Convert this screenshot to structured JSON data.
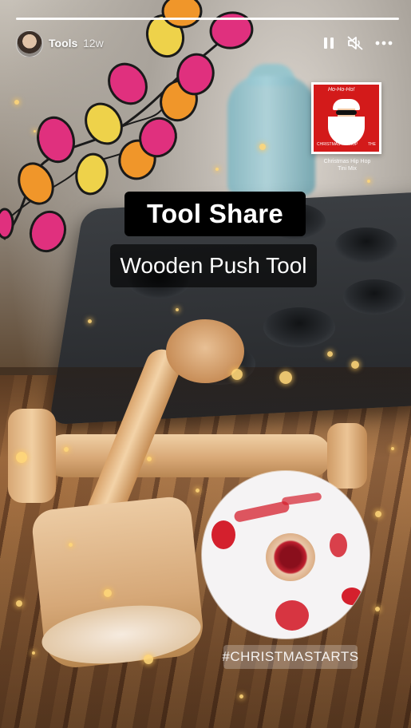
{
  "header": {
    "username": "Tools",
    "time_ago": "12w",
    "progress_fraction": 1.0
  },
  "controls": {
    "pause_icon": "pause-icon",
    "mute_icon": "speaker-muted-icon",
    "more_icon": "more-horizontal-icon"
  },
  "stickers": {
    "title": "Tool Share",
    "subtitle": "Wooden Push Tool",
    "hashtag": "#CHRISTMASTARTS"
  },
  "music": {
    "art_text": "Ho-Ho-Ho!",
    "art_brand_left": "CHRISTMAS HIP HOP",
    "art_brand_right": "THE",
    "caption_line1": "Christmas Hip Hop",
    "caption_line2": "Tini Mix"
  },
  "colors": {
    "title_bg": "#000000",
    "music_art": "#d31a1a",
    "light_pink": "#e0307e",
    "light_orange": "#f0962a",
    "light_yellow": "#eed24a"
  }
}
